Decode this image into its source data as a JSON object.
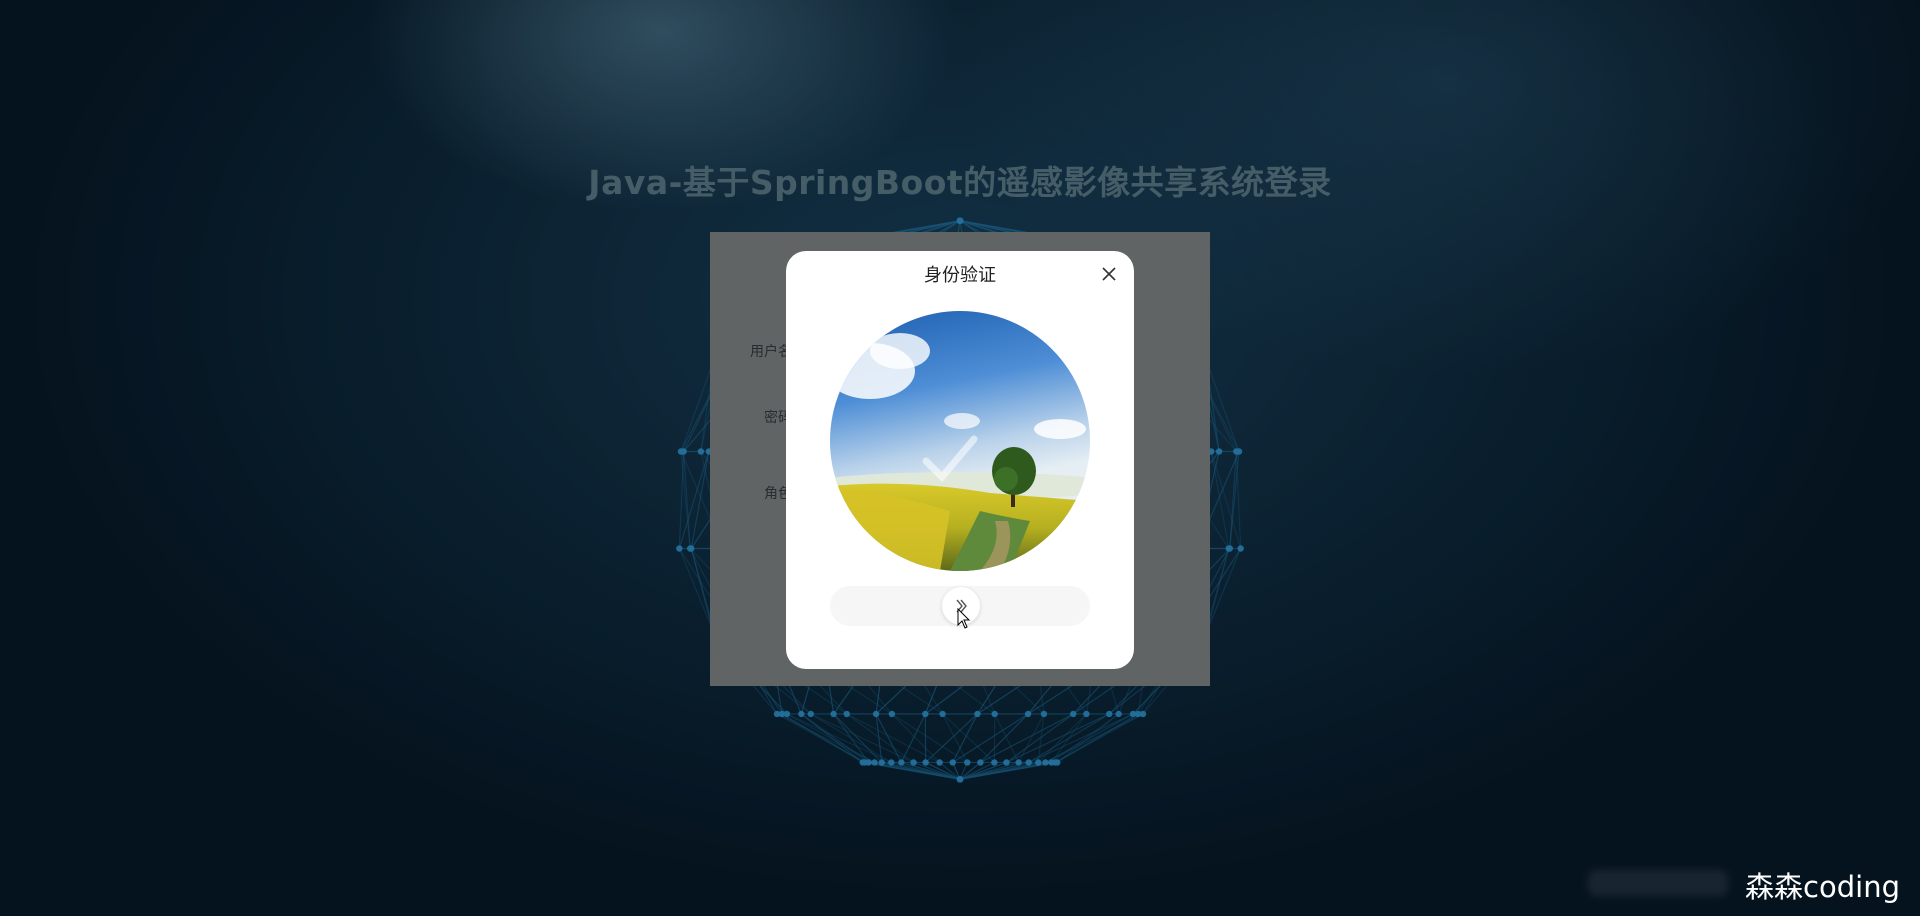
{
  "page": {
    "title": "Java-基于SpringBoot的遥感影像共享系统登录"
  },
  "login_form": {
    "labels": [
      "用户名",
      "密码",
      "角色"
    ]
  },
  "captcha_dialog": {
    "title": "身份验证",
    "close_icon": "close-icon",
    "image_icon": "checkmark-icon",
    "slider_icon": "double-chevron-right-icon"
  },
  "watermark": {
    "text": "森森coding"
  },
  "colors": {
    "background": "#0b2233",
    "title": "#4f6a75",
    "panel": "#6f7273",
    "modal": "#ffffff",
    "slider_track": "#f6f6f6"
  }
}
